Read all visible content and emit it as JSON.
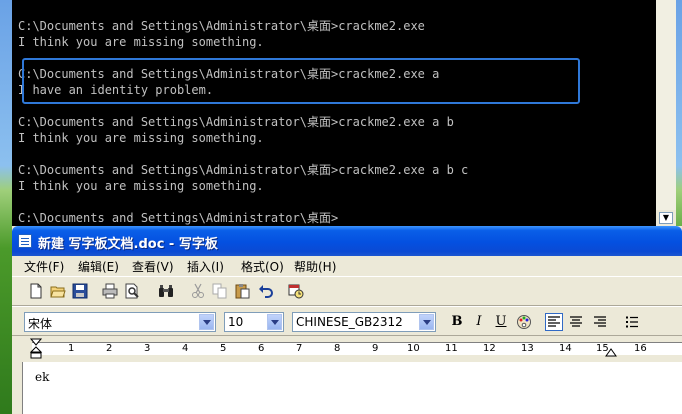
{
  "console": {
    "lines": [
      "C:\\Documents and Settings\\Administrator\\桌面>crackme2.exe",
      "I think you are missing something.",
      "",
      "C:\\Documents and Settings\\Administrator\\桌面>crackme2.exe a",
      "I have an identity problem.",
      "",
      "C:\\Documents and Settings\\Administrator\\桌面>crackme2.exe a b",
      "I think you are missing something.",
      "",
      "C:\\Documents and Settings\\Administrator\\桌面>crackme2.exe a b c",
      "I think you are missing something.",
      "",
      "C:\\Documents and Settings\\Administrator\\桌面>"
    ],
    "scroll_arrow": "▼"
  },
  "wordpad": {
    "title": "新建 写字板文档.doc - 写字板",
    "menu": [
      "文件(F)",
      "编辑(E)",
      "查看(V)",
      "插入(I)",
      "格式(O)",
      "帮助(H)"
    ],
    "font_name": "宋体",
    "font_size": "10",
    "script": "CHINESE_GB2312",
    "bold_label": "B",
    "italic_label": "I",
    "underline_label": "U",
    "ruler_numbers": [
      "1",
      "2",
      "3",
      "4",
      "5",
      "6",
      "7",
      "8",
      "9",
      "10",
      "11",
      "12",
      "13",
      "14",
      "15",
      "16"
    ],
    "document_text": "ek"
  },
  "icons": {
    "new": "new-document-icon",
    "open": "open-folder-icon",
    "save": "save-disk-icon",
    "print": "print-icon",
    "preview": "print-preview-icon",
    "find": "find-binoculars-icon",
    "cut": "cut-scissors-icon",
    "copy": "copy-icon",
    "paste": "paste-icon",
    "undo": "undo-icon",
    "datetime": "date-time-icon",
    "color": "color-palette-icon",
    "align_left": "align-left-icon",
    "align_center": "align-center-icon",
    "align_right": "align-right-icon",
    "bullets": "bullets-icon"
  }
}
